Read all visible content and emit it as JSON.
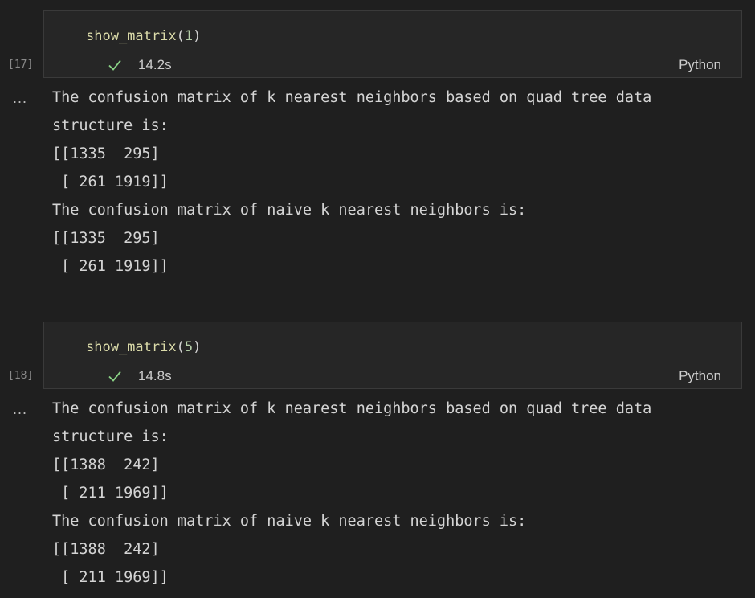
{
  "cells": [
    {
      "exec_count": "[17]",
      "code": {
        "fn": "show_matrix",
        "open": "(",
        "arg": "1",
        "close": ")"
      },
      "duration": "14.2s",
      "language": "Python",
      "output_more": "...",
      "output_lines": [
        "The confusion matrix of k nearest neighbors based on quad tree data",
        "structure is:",
        "[[1335  295]",
        " [ 261 1919]]",
        "The confusion matrix of naive k nearest neighbors is:",
        "[[1335  295]",
        " [ 261 1919]]"
      ]
    },
    {
      "exec_count": "[18]",
      "code": {
        "fn": "show_matrix",
        "open": "(",
        "arg": "5",
        "close": ")"
      },
      "duration": "14.8s",
      "language": "Python",
      "output_more": "...",
      "output_lines": [
        "The confusion matrix of k nearest neighbors based on quad tree data",
        "structure is:",
        "[[1388  242]",
        " [ 211 1969]]",
        "The confusion matrix of naive k nearest neighbors is:",
        "[[1388  242]",
        " [ 211 1969]]"
      ]
    }
  ],
  "colors": {
    "background": "#1f1f1f",
    "success_check": "#89d185",
    "function_name": "#dcdcaa",
    "number_literal": "#b5cea8"
  },
  "icons": {
    "success": "check-icon",
    "output_actions": "ellipsis-icon"
  }
}
